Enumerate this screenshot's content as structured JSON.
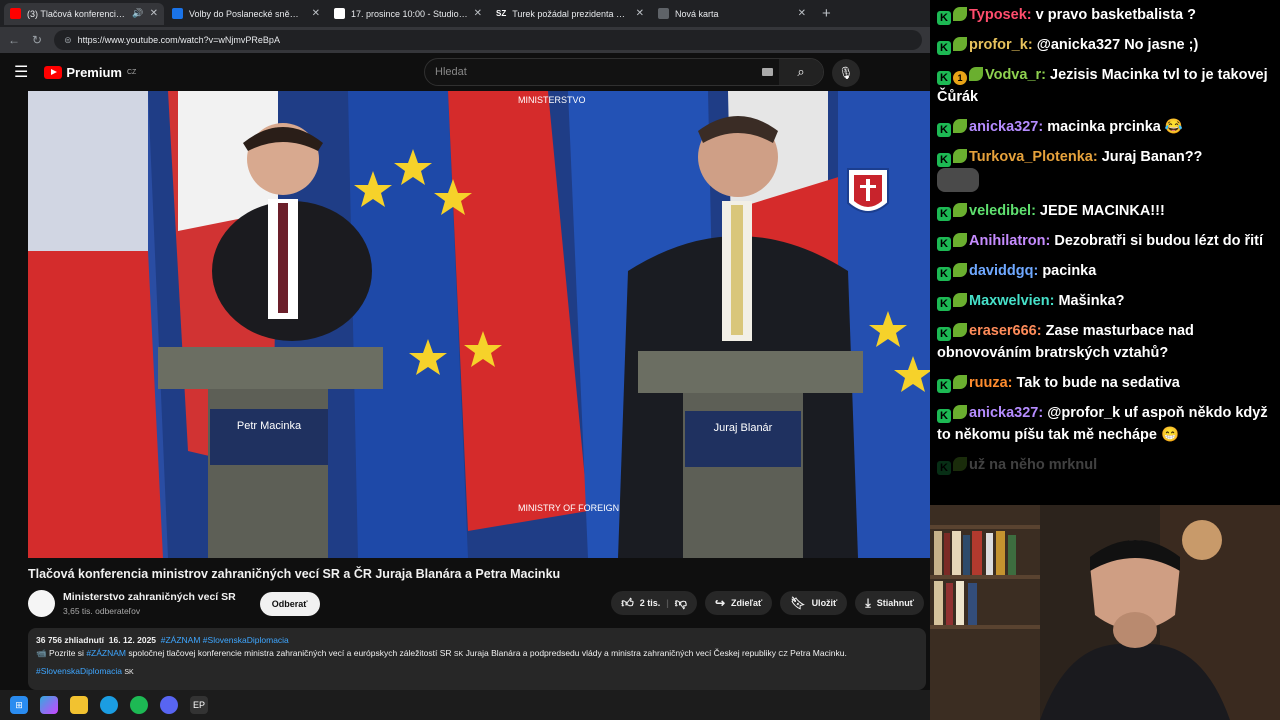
{
  "tabs": [
    {
      "title": "(3) Tlačová konferencia minist",
      "color": "#ff0000",
      "active": true
    },
    {
      "title": "Volby do Poslanecké sněmovny 20",
      "color": "#1a73e8",
      "active": false
    },
    {
      "title": "17. prosince 10:00 - Studio ČT24 |",
      "color": "#ffffff",
      "active": false
    },
    {
      "title": "Turek požádal prezidenta o schůz",
      "color": "#c0392b",
      "favtext": "SZ",
      "active": false
    },
    {
      "title": "Nová karta",
      "color": "#5f6368",
      "active": false
    }
  ],
  "url": "https://www.youtube.com/watch?v=wNjmvPReBpA",
  "youtube": {
    "logo_text": "Premium",
    "logo_sup": "CZ",
    "search_placeholder": "Hledat"
  },
  "video": {
    "title": "Tlačová konferencia ministrov zahraničných vecí SR a ČR Juraja Blanára a Petra Macinku",
    "channel": "Ministerstvo zahraničných vecí SR",
    "subscribers": "3,65 tis. odberateľov",
    "subscribe_label": "Odberať",
    "likes": "2 tis.",
    "share_label": "Zdieľať",
    "save_label": "Uložiť",
    "download_label": "Stiahnuť",
    "nameplate_left": "Petr Macinka",
    "nameplate_right": "Juraj Blanár",
    "backdrop_text_1": "MINISTERSTVO ZAHRANIČNÝCH VECÍ A EURÓPSKYCH ZÁLEŽITOSTÍ SLOVENSKEJ REPUBLIKY",
    "backdrop_text_2": "MINISTRY OF FOREIGN AND EUROPEAN AFFAIRS OF THE SLOVAK REPUBLIC"
  },
  "description": {
    "views": "36 756 zhliadnutí",
    "date": "16. 12. 2025",
    "tags": "#ZÁZNAM #SlovenskaDiplomacia",
    "line_prefix": "Pozrite si",
    "line_tag": "#ZÁZNAM",
    "line_text": "spoločnej tlačovej konferencie ministra zahraničných vecí a európskych záležitostí SR",
    "line_text2": "Juraja Blanára a podpredsedu vlády a ministra zahraničných vecí Českej republiky",
    "line_text3": "Petra Macinku.",
    "flag_sk": "SK",
    "flag_cz": "CZ",
    "bottom_tag": "#SlovenskaDiplomacia",
    "bottom_flag": "SK"
  },
  "chat": [
    {
      "user": "Typosek",
      "color": "#ff4d6d",
      "text": "v pravo basketbalista ?"
    },
    {
      "user": "profor_k",
      "color": "#e6c15c",
      "text": "@anicka327 No jasne ;)"
    },
    {
      "user": "Vodva_r",
      "color": "#8fd14f",
      "text": "Jezisis Macinka tvl to je takovej Čůrák",
      "extra_badge": "1"
    },
    {
      "user": "anicka327",
      "color": "#b58cff",
      "text": "macinka prcinka 😂"
    },
    {
      "user": "Turkova_Plotenka",
      "color": "#e6a23c",
      "text": "Juraj Banan??",
      "emote": true
    },
    {
      "user": "veledibel",
      "color": "#5fe06f",
      "text": "JEDE MACINKA!!!"
    },
    {
      "user": "Anihilatron",
      "color": "#c68cff",
      "text": "Dezobratři si budou lézt do řití"
    },
    {
      "user": "daviddgq",
      "color": "#6fa8ff",
      "text": "pacinka"
    },
    {
      "user": "Maxwelvien",
      "color": "#46e0c9",
      "text": "Mašinka?"
    },
    {
      "user": "eraser666",
      "color": "#ff8c5a",
      "text": "Zase masturbace nad obnovováním bratrských vztahů?"
    },
    {
      "user": "ruuza",
      "color": "#ff8c2e",
      "text": "Tak to bude na sedativa"
    },
    {
      "user": "anicka327",
      "color": "#b58cff",
      "text": "@profor_k uf aspoň někdo když to někomu píšu tak mě nechápe 😁"
    },
    {
      "user": "",
      "color": "#666666",
      "text": "už na něho mrknul",
      "faded": true
    }
  ]
}
